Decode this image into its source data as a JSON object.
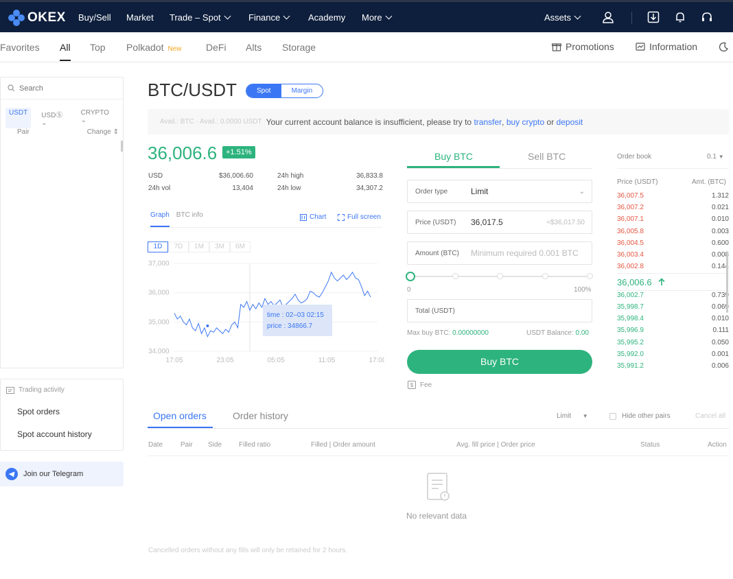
{
  "topbar": {
    "brand": "OKEX",
    "nav": [
      {
        "label": "Buy/Sell",
        "dropdown": false
      },
      {
        "label": "Market",
        "dropdown": false
      },
      {
        "label": "Trade – Spot",
        "dropdown": true
      },
      {
        "label": "Finance",
        "dropdown": true
      },
      {
        "label": "Academy",
        "dropdown": false
      },
      {
        "label": "More",
        "dropdown": true
      }
    ],
    "assets_label": "Assets",
    "icons": [
      "user-icon",
      "download-icon",
      "bell-icon",
      "headset-icon"
    ]
  },
  "subnav": {
    "tabs": [
      "Favorites",
      "All",
      "Top",
      "Polkadot",
      "DeFi",
      "Alts",
      "Storage"
    ],
    "active": "All",
    "new_badge": "New",
    "promotions": "Promotions",
    "information": "Information"
  },
  "left": {
    "search_placeholder": "Search",
    "market_tabs": [
      "USDT",
      "USDⓈ",
      "CRYPTO"
    ],
    "pair_header": "Pair",
    "change_header": "Change",
    "activity_title": "Trading activity",
    "links": [
      "Spot orders",
      "Spot account history"
    ],
    "telegram": "Join our Telegram"
  },
  "pair": {
    "title": "BTC/USDT",
    "spot": "Spot",
    "margin": "Margin"
  },
  "notice": {
    "ghost": "Avail.: BTC · Avail.: 0.0000 USDT",
    "text": "Your current account balance is insufficient, please try to",
    "transfer": "transfer",
    "comma": ",",
    "buy_crypto": "buy crypto",
    "or": "or",
    "deposit": "deposit"
  },
  "ticker": {
    "price": "36,006.6",
    "change": "+1.51%",
    "usd_label": "USD",
    "usd_value": "$36,006.60",
    "vol_label": "24h vol",
    "vol_value": "13,404",
    "high_label": "24h high",
    "high_value": "36,833.8",
    "low_label": "24h low",
    "low_value": "34,307.2"
  },
  "graph": {
    "tabs": [
      "Graph",
      "BTC info"
    ],
    "chart_link": "Chart",
    "fullscreen_link": "Full screen",
    "ranges": [
      "1D",
      "7D",
      "1M",
      "3M",
      "6M"
    ],
    "tooltip_time": "time : 02–03 02:15",
    "tooltip_price": "price : 34866.7"
  },
  "chart_data": {
    "type": "line",
    "x_labels": [
      "17:05",
      "23:05",
      "05:05",
      "11:05",
      "17:00"
    ],
    "y_ticks": [
      "37,000",
      "36,000",
      "35,000",
      "34,000"
    ],
    "ylim": [
      34000,
      37000
    ],
    "values": [
      35300,
      35100,
      35200,
      35000,
      34900,
      35100,
      34800,
      34700,
      34950,
      34600,
      34800,
      34500,
      34700,
      34650,
      34800,
      34700,
      34600,
      34750,
      34650,
      34900,
      35000,
      34800,
      35600,
      35500,
      35700,
      35400,
      35600,
      35450,
      35650,
      35500,
      35800,
      35600,
      35700,
      35550,
      35650,
      35750,
      35500,
      35600,
      35700,
      35800,
      35950,
      35750,
      35650,
      35700,
      35800,
      36050,
      36000,
      35900,
      35850,
      36000,
      36200,
      36400,
      36700,
      36500,
      36400,
      36500,
      36600,
      36450,
      36550,
      36700,
      36500,
      36450,
      36200,
      35900,
      36050,
      35850
    ],
    "highlight": {
      "time": "02–03 02:15",
      "price": 34866.7
    }
  },
  "trade": {
    "buy_tab": "Buy BTC",
    "sell_tab": "Sell BTC",
    "order_type_label": "Order type",
    "order_type_value": "Limit",
    "price_label": "Price  (USDT)",
    "price_value": "36,017.5",
    "price_hint": "≈$36,017.50",
    "amount_label": "Amount (BTC)",
    "amount_placeholder": "Minimum required 0.001 BTC",
    "slider_min": "0",
    "slider_max": "100%",
    "slider_fraction": 0,
    "total_label": "Total (USDT)",
    "maxbuy_label": "Max buy BTC: ",
    "maxbuy_value": "0.00000000",
    "balance_label": "USDT Balance: ",
    "balance_value": "0.00",
    "buy_button": "Buy BTC",
    "fee": "Fee"
  },
  "orderbook": {
    "title": "Order book",
    "size": "0.1",
    "price_col": "Price (USDT)",
    "amount_col": "Amt. (BTC)",
    "asks": [
      {
        "price": "36,007.5",
        "amount": "1.312"
      },
      {
        "price": "36,007.2",
        "amount": "0.021"
      },
      {
        "price": "36,007.1",
        "amount": "0.010"
      },
      {
        "price": "36,005.8",
        "amount": "0.003"
      },
      {
        "price": "36,004.5",
        "amount": "0.600"
      },
      {
        "price": "36,003.4",
        "amount": "0.008"
      },
      {
        "price": "36,002.8",
        "amount": "0.144"
      }
    ],
    "last": "36,006.6",
    "bids": [
      {
        "price": "36,002.7",
        "amount": "0.739"
      },
      {
        "price": "35,998.7",
        "amount": "0.069"
      },
      {
        "price": "35,998.4",
        "amount": "0.010"
      },
      {
        "price": "35,996.9",
        "amount": "0.111"
      },
      {
        "price": "35,995.2",
        "amount": "0.050"
      },
      {
        "price": "35,992.0",
        "amount": "0.001"
      },
      {
        "price": "35,991.2",
        "amount": "0.006"
      }
    ]
  },
  "orders": {
    "tabs": [
      "Open orders",
      "Order history"
    ],
    "filter": "Limit",
    "hide_other": "Hide other pairs",
    "cancel_all": "Cancel all",
    "columns": [
      "Date",
      "Pair",
      "Side",
      "Filled ratio",
      "Filled | Order amount",
      "Avg. fill price | Order price",
      "Status",
      "Action"
    ],
    "empty": "No relevant data",
    "note": "Cancelled orders without any fills will only be retained for 2 hours."
  },
  "colors": {
    "green": "#2db37d",
    "red": "#e55541",
    "blue": "#3b76f4",
    "navy": "#0e1f3d"
  }
}
